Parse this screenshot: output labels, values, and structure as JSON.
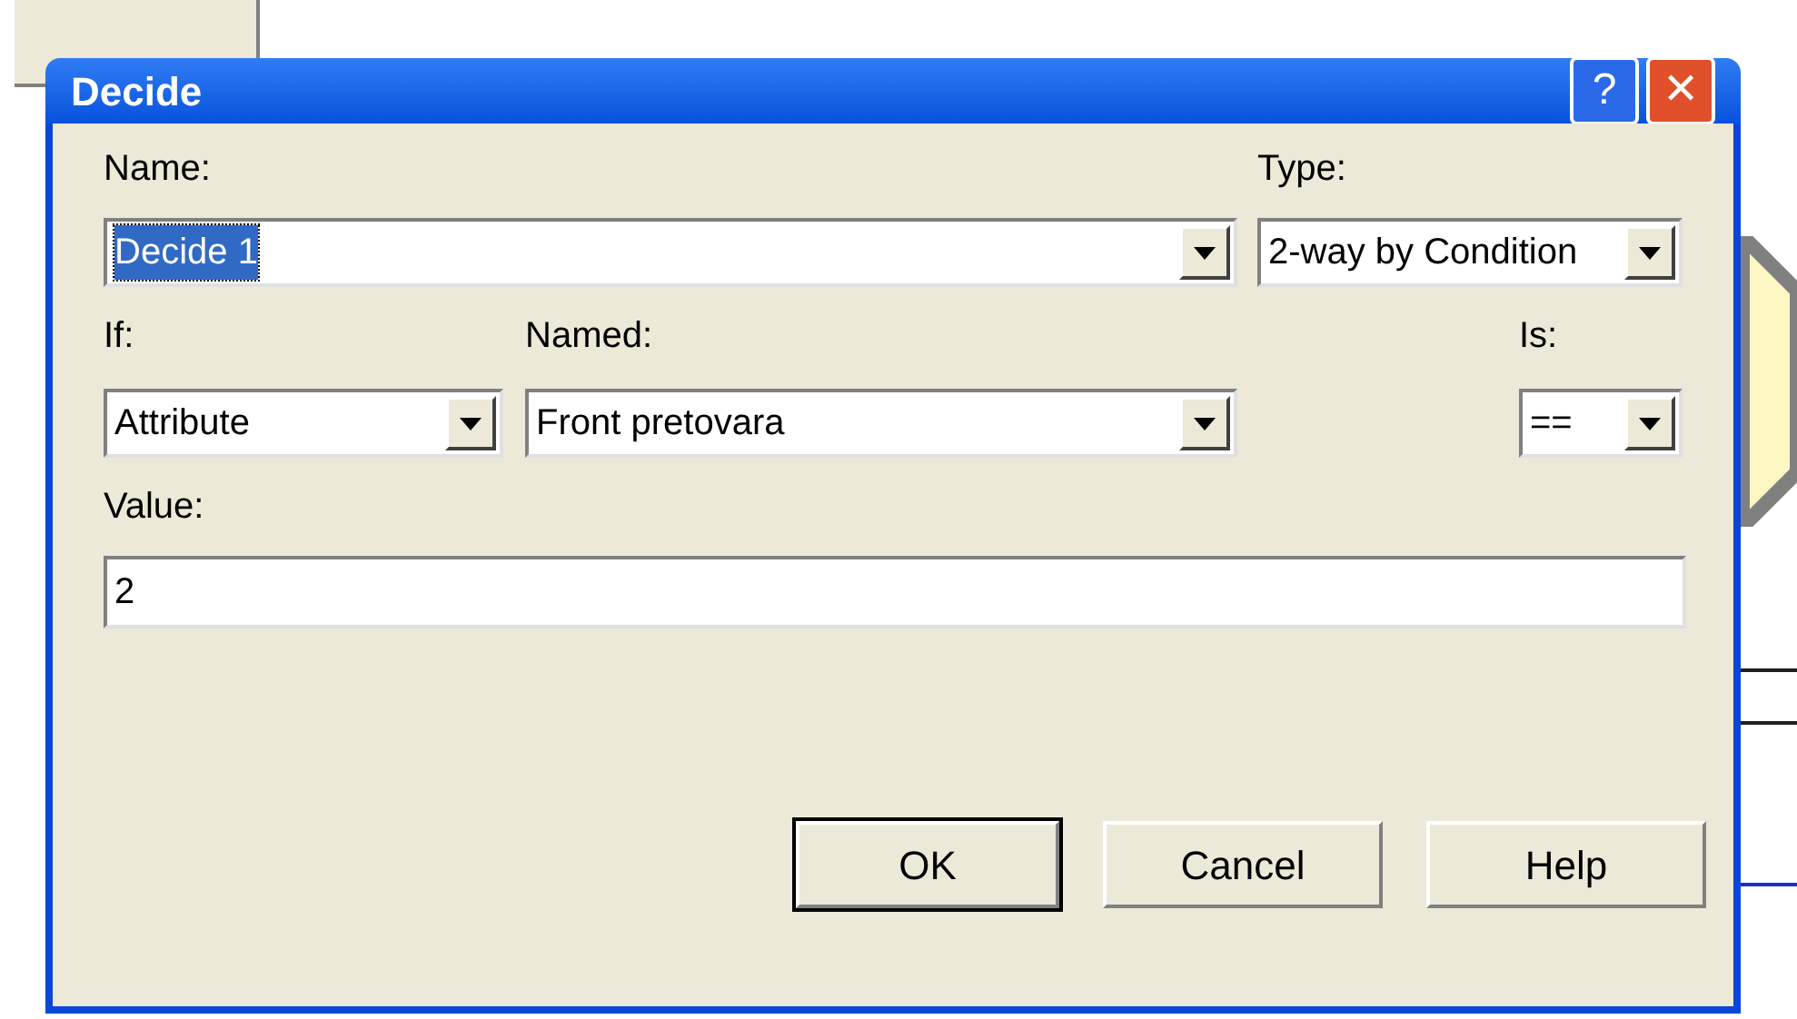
{
  "window": {
    "title": "Decide"
  },
  "title_buttons": [
    {
      "kind": "help",
      "label": "?"
    },
    {
      "kind": "close",
      "label": "✕"
    }
  ],
  "name": {
    "label": "Name:",
    "value": "Decide 1",
    "text_selected": true
  },
  "type": {
    "label": "Type:",
    "value": "2-way by Condition"
  },
  "if": {
    "label": "If:",
    "value": "Attribute"
  },
  "named": {
    "label": "Named:",
    "value": "Front pretovara"
  },
  "is": {
    "label": "Is:",
    "value": "=="
  },
  "value": {
    "label": "Value:",
    "value": "2"
  },
  "buttons": [
    {
      "label": "OK",
      "default": true
    },
    {
      "label": "Cancel",
      "default": false
    },
    {
      "label": "Help",
      "default": false
    }
  ]
}
